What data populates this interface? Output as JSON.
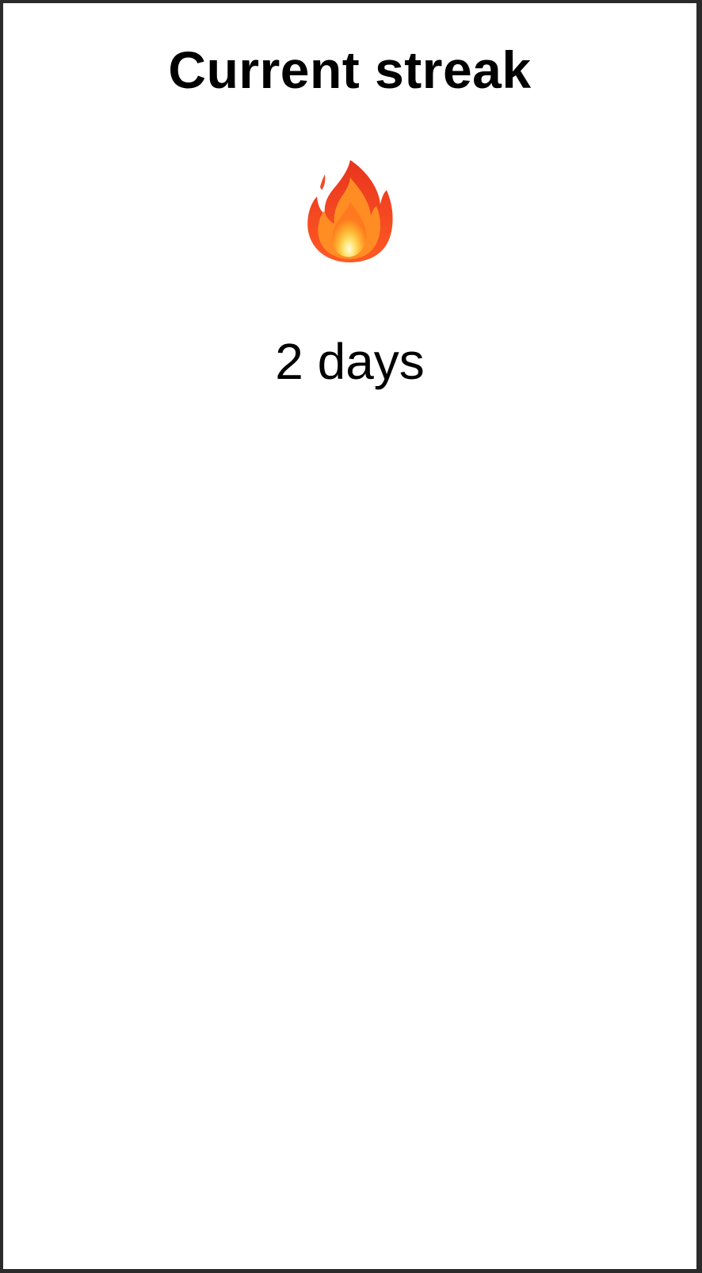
{
  "streak": {
    "title": "Current streak",
    "icon": "fire-icon",
    "value_text": "2 days"
  },
  "colors": {
    "background": "#ffffff",
    "text": "#000000",
    "frame": "#2b2b2b",
    "flame_outer": "#f0452a",
    "flame_mid": "#ff8a1f",
    "flame_inner": "#ffd33b"
  }
}
